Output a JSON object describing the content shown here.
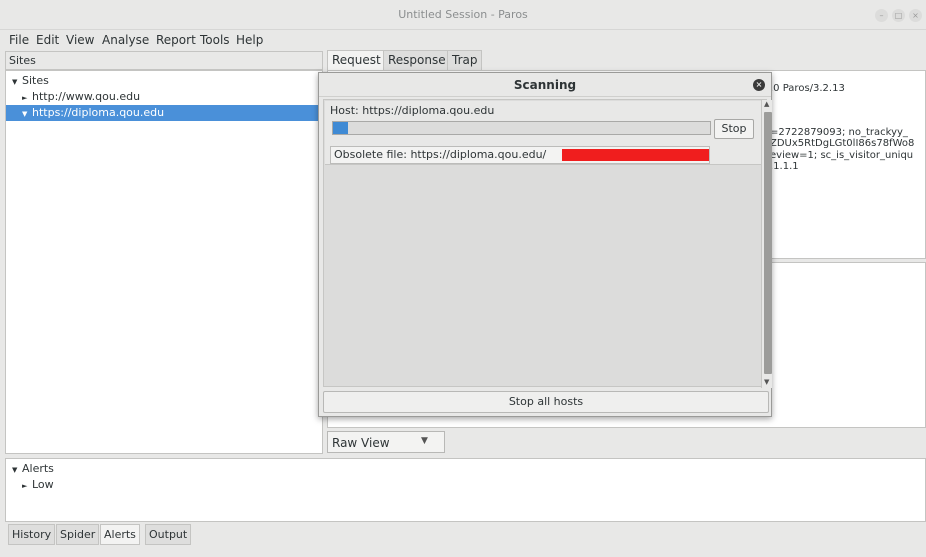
{
  "window": {
    "title": "Untitled Session - Paros"
  },
  "menu": {
    "items": [
      "File",
      "Edit",
      "View",
      "Analyse",
      "Report",
      "Tools",
      "Help"
    ]
  },
  "sites": {
    "header": "Sites",
    "root": "Sites",
    "items": [
      "http://www.qou.edu",
      "https://diploma.qou.edu"
    ]
  },
  "tabs": {
    "request": "Request",
    "response": "Response",
    "trap": "Trap"
  },
  "request_text": {
    "line1": ".0 Paros/3.2.13",
    "line2": "=2722879093; no_trackyy_",
    "line3": "ZDUx5RtDgLGt0lI86s78fWo8",
    "line4": "eview=1; sc_is_visitor_uniqu",
    "line5": ".1.1.1"
  },
  "view_select": {
    "value": "Raw View"
  },
  "alerts": {
    "root": "Alerts",
    "items": [
      "Low"
    ]
  },
  "bottom_tabs": {
    "history": "History",
    "spider": "Spider",
    "alerts": "Alerts",
    "output": "Output"
  },
  "scan_dialog": {
    "title": "Scanning",
    "host_label": "Host:  https://diploma.qou.edu",
    "progress": 0.04,
    "stop_label": "Stop",
    "file_label": "Obsolete file: https://diploma.qou.edu/",
    "stop_all_label": "Stop all hosts"
  },
  "colors": {
    "selection": "#4a90d9",
    "progress": "#3f8ad4",
    "redaction": "#f01e1e"
  }
}
